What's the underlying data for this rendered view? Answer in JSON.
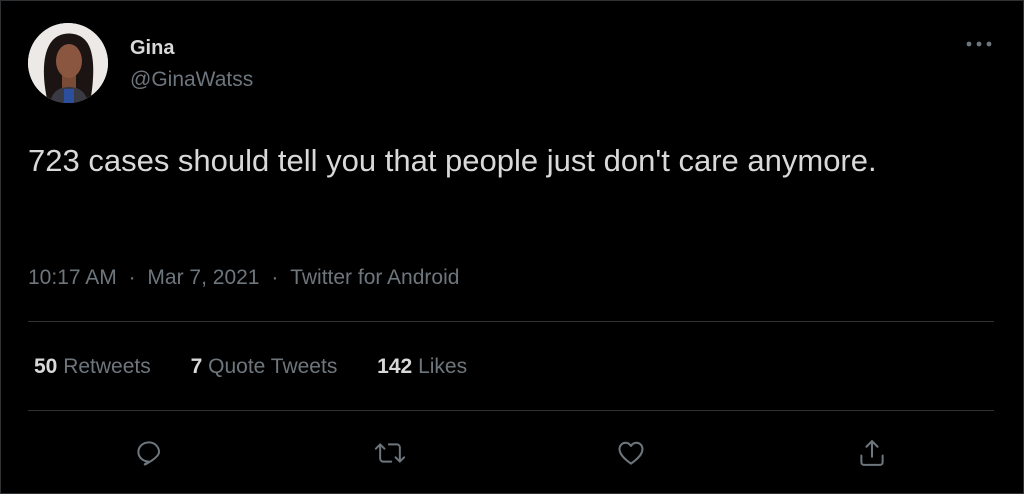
{
  "tweet": {
    "author": {
      "display_name": "Gina",
      "handle": "@GinaWatss",
      "avatar_icon": "profile-photo"
    },
    "text": "723 cases should tell you that people just don't care anymore.",
    "time": "10:17 AM",
    "date": "Mar 7, 2021",
    "source": "Twitter for Android",
    "separator": "·",
    "stats": {
      "retweets": {
        "count": "50",
        "label": "Retweets"
      },
      "quote_tweets": {
        "count": "7",
        "label": "Quote Tweets"
      },
      "likes": {
        "count": "142",
        "label": "Likes"
      }
    },
    "actions": [
      {
        "icon": "reply-icon"
      },
      {
        "icon": "retweet-icon"
      },
      {
        "icon": "like-icon"
      },
      {
        "icon": "share-icon"
      }
    ]
  },
  "colors": {
    "background": "#000000",
    "primary_text": "#d9d9d9",
    "secondary_text": "#6e767d",
    "divider": "#2f3336"
  }
}
